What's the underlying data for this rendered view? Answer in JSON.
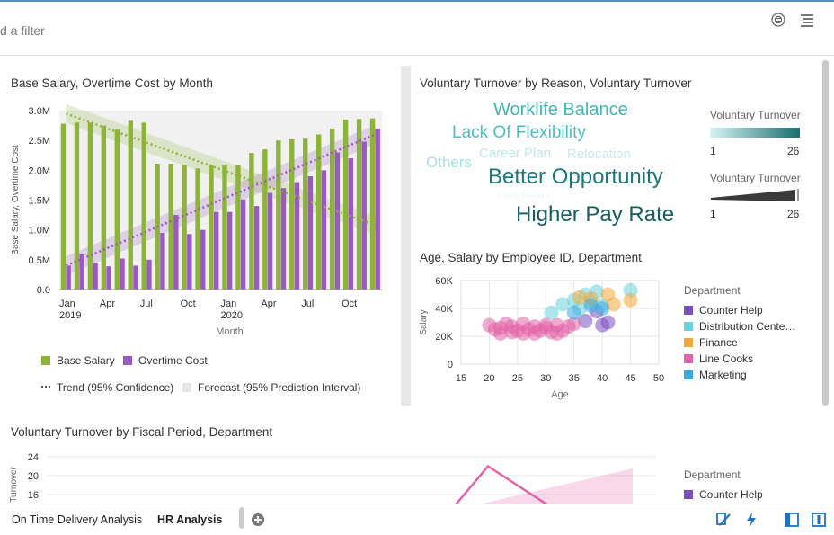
{
  "filterbar": {
    "placeholder_text": "d a filter",
    "icons": [
      "settings-icon",
      "menu-icon"
    ]
  },
  "panels": {
    "salary": {
      "title": "Base Salary, Overtime Cost by Month",
      "legend": {
        "base": "Base Salary",
        "overtime": "Overtime Cost",
        "trend": "Trend (95% Confidence)",
        "forecast": "Forecast (95% Prediction Interval)"
      }
    },
    "turnover_reason": {
      "title": "Voluntary Turnover by Reason, Voluntary Turnover",
      "words": [
        "Worklife Balance",
        "Lack Of Flexibility",
        "Career Plan",
        "Relocation",
        "Others",
        "Better Opportunity",
        "Family Reasons",
        "Higher Pay Rate"
      ],
      "legend1": {
        "title": "Voluntary Turnover",
        "min": "1",
        "max": "26"
      },
      "legend2": {
        "title": "Voluntary Turnover",
        "min": "1",
        "max": "26"
      }
    },
    "age_salary": {
      "title": "Age, Salary by Employee ID, Department"
    },
    "fiscal": {
      "title": "Voluntary Turnover by Fiscal Period, Department",
      "legend_title": "Department",
      "legend_first": "Counter Help"
    }
  },
  "tabs": [
    {
      "label": "On Time Delivery Analysis",
      "active": false
    },
    {
      "label": "HR Analysis",
      "active": true
    }
  ],
  "bottom_icons": [
    "add-canvas-icon",
    "brush-icon",
    "lightning-icon",
    "left-panel-icon",
    "right-panel-icon"
  ],
  "chart_data": [
    {
      "type": "bar",
      "title": "Base Salary, Overtime Cost by Month",
      "xlabel": "Month",
      "ylabel": "Base Salary, Overtime Cost",
      "ylim": [
        0,
        3000000
      ],
      "yticks": [
        "0.0",
        "0.5M",
        "1.0M",
        "1.5M",
        "2.0M",
        "2.5M",
        "3.0M"
      ],
      "xticks": [
        "Jan\n2019",
        "Apr",
        "Jul",
        "Oct",
        "Jan\n2020",
        "Apr",
        "Jul",
        "Oct"
      ],
      "categories": [
        "2019-01",
        "2019-02",
        "2019-03",
        "2019-04",
        "2019-05",
        "2019-06",
        "2019-07",
        "2019-08",
        "2019-09",
        "2019-10",
        "2019-11",
        "2019-12",
        "2020-01",
        "2020-02",
        "2020-03",
        "2020-04",
        "2020-05",
        "2020-06",
        "2020-07",
        "2020-08",
        "2020-09",
        "2020-10",
        "2020-11",
        "2020-12"
      ],
      "series": [
        {
          "name": "Base Salary",
          "color": "#8db33a",
          "values": [
            2780000,
            2800000,
            2800000,
            2750000,
            2680000,
            2830000,
            2800000,
            2110000,
            2110000,
            2090000,
            2030000,
            2080000,
            2090000,
            2080000,
            2290000,
            2350000,
            2500000,
            2520000,
            2530000,
            2600000,
            2700000,
            2850000,
            2860000,
            2870000
          ]
        },
        {
          "name": "Overtime Cost",
          "color": "#9b59c5",
          "values": [
            400000,
            590000,
            450000,
            390000,
            520000,
            400000,
            500000,
            950000,
            1250000,
            930000,
            1000000,
            1300000,
            1300000,
            1510000,
            1400000,
            1620000,
            1700000,
            1800000,
            1900000,
            2000000,
            2300000,
            2200000,
            2480000,
            2700000
          ]
        }
      ],
      "trend_series": [
        {
          "name": "Base Salary trend",
          "color": "#8db33a",
          "from": 2950000,
          "to": 1080000
        },
        {
          "name": "Overtime Cost trend",
          "color": "#9b59c5",
          "from": 400000,
          "to": 2600000
        }
      ],
      "legend": "bottom"
    },
    {
      "type": "scatter",
      "title": "Age, Salary by Employee ID, Department",
      "xlabel": "Age",
      "ylabel": "Salary",
      "xlim": [
        15,
        50
      ],
      "ylim": [
        0,
        60000
      ],
      "xticks": [
        "15",
        "20",
        "25",
        "30",
        "35",
        "40",
        "45",
        "50"
      ],
      "yticks": [
        "0",
        "20K",
        "40K",
        "60K"
      ],
      "legend_title": "Department",
      "series": [
        {
          "name": "Counter Help",
          "color": "#7a4fc0",
          "points": [
            [
              39,
              38000
            ],
            [
              41,
              30000
            ],
            [
              40,
              28000
            ],
            [
              37,
              31000
            ]
          ]
        },
        {
          "name": "Distribution Cente…",
          "color": "#6ad4de",
          "points": [
            [
              33,
              43000
            ],
            [
              35,
              46000
            ],
            [
              37,
              50000
            ],
            [
              38,
              44000
            ],
            [
              39,
              52000
            ],
            [
              45,
              53000
            ],
            [
              36,
              40000
            ],
            [
              31,
              37000
            ],
            [
              40,
              42000
            ]
          ]
        },
        {
          "name": "Finance",
          "color": "#f2a93b",
          "points": [
            [
              36,
              48000
            ],
            [
              41,
              50000
            ],
            [
              42,
              43000
            ],
            [
              45,
              46000
            ],
            [
              38,
              47000
            ]
          ]
        },
        {
          "name": "Line Cooks",
          "color": "#e264a8",
          "points": [
            [
              20,
              28000
            ],
            [
              21,
              25000
            ],
            [
              22,
              26000
            ],
            [
              23,
              29000
            ],
            [
              24,
              27000
            ],
            [
              25,
              24000
            ],
            [
              26,
              29000
            ],
            [
              27,
              25000
            ],
            [
              28,
              27000
            ],
            [
              29,
              24000
            ],
            [
              30,
              28000
            ],
            [
              22,
              22000
            ],
            [
              24,
              23000
            ],
            [
              26,
              22000
            ],
            [
              28,
              22000
            ],
            [
              32,
              28000
            ],
            [
              33,
              24000
            ],
            [
              34,
              27000
            ],
            [
              32,
              22000
            ],
            [
              35,
              29000
            ],
            [
              30,
              26000
            ],
            [
              31,
              23000
            ]
          ]
        },
        {
          "name": "Marketing",
          "color": "#3ba9e0",
          "points": [
            [
              38,
              42000
            ],
            [
              40,
              40000
            ],
            [
              35,
              37000
            ]
          ]
        }
      ]
    },
    {
      "type": "line",
      "title": "Voluntary Turnover by Fiscal Period, Department",
      "ylabel": "Voluntary Turnover",
      "yticks": [
        "16",
        "20",
        "24"
      ],
      "ylim": [
        12,
        24
      ],
      "legend_title": "Department",
      "series": [
        {
          "name": "Counter Help",
          "color": "#e264a8",
          "points": [
            [
              0,
              10
            ],
            [
              1,
              22
            ],
            [
              2,
              10
            ]
          ]
        }
      ]
    }
  ]
}
